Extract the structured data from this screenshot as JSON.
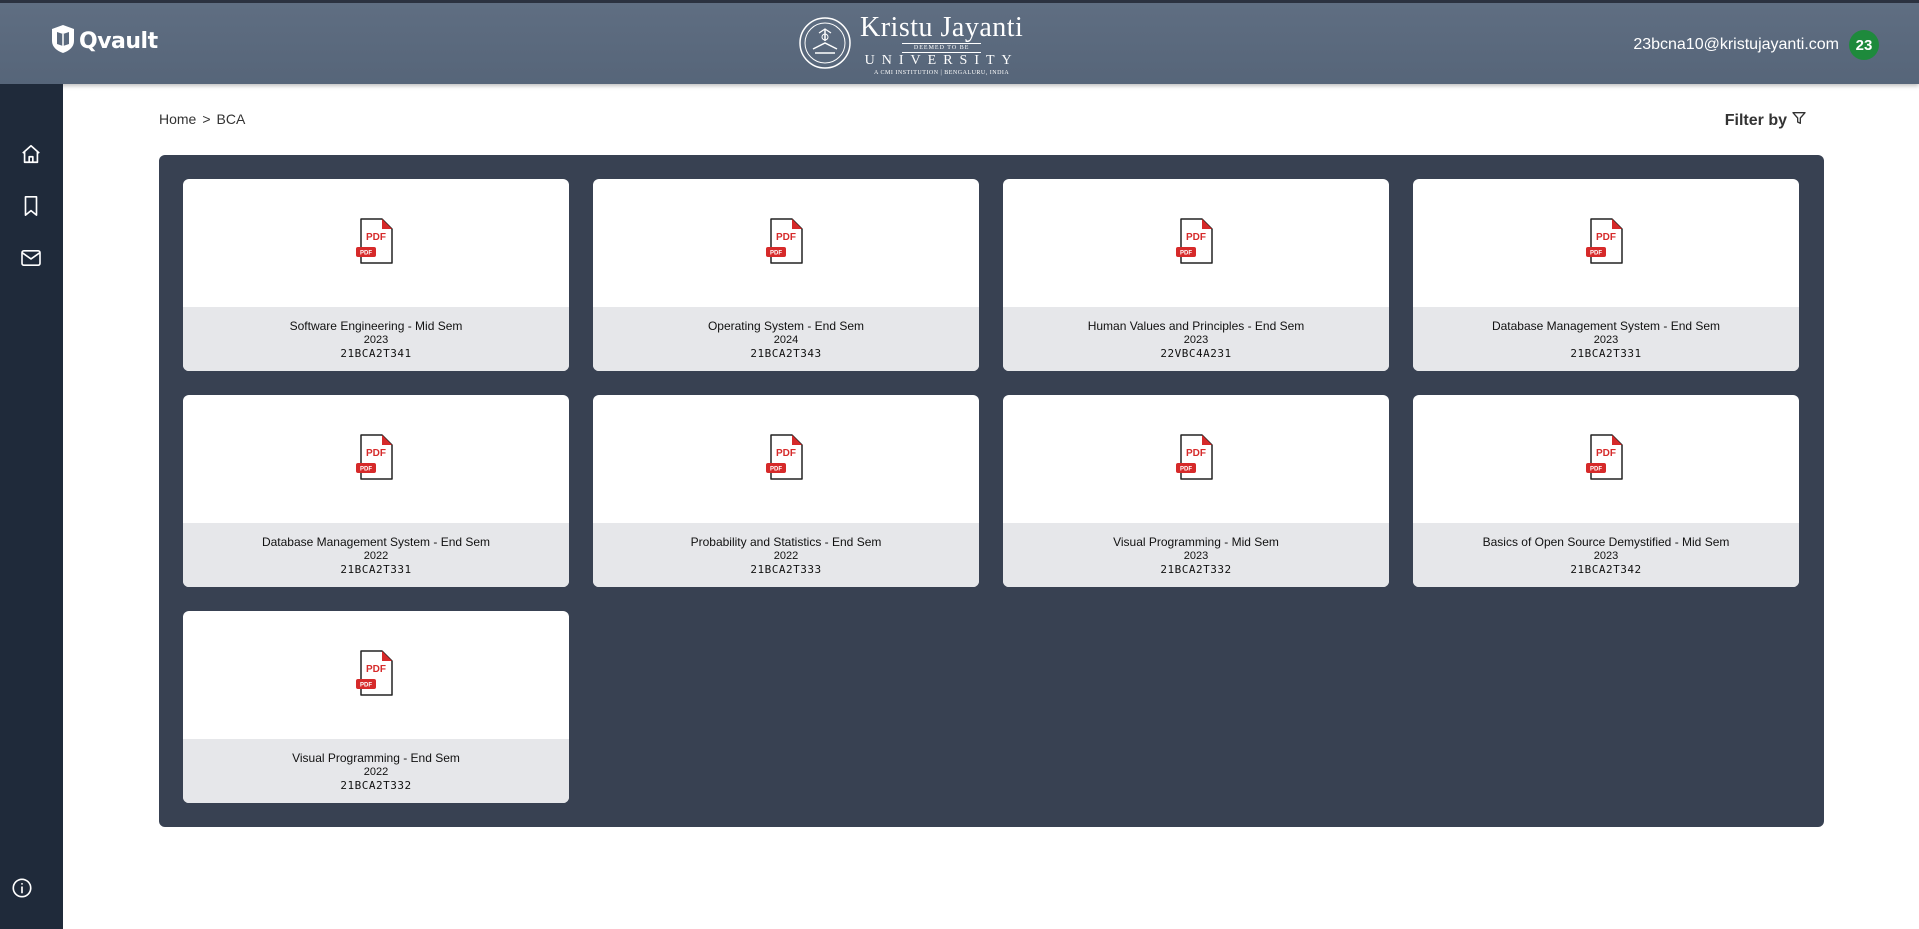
{
  "header": {
    "app_name": "Qvault",
    "university": {
      "name": "Kristu Jayanti",
      "deemed": "DEEMED TO BE",
      "word": "UNIVERSITY",
      "tagline": "A CMI INSTITUTION | BENGALURU, INDIA"
    },
    "user_email": "23bcna10@kristujayanti.com",
    "avatar_text": "23"
  },
  "sidebar": {
    "items": [
      {
        "icon": "home-icon"
      },
      {
        "icon": "bookmark-icon"
      },
      {
        "icon": "mail-icon"
      }
    ],
    "bottom_icon": "info-icon"
  },
  "breadcrumb": {
    "home": "Home",
    "separator": ">",
    "current": "BCA"
  },
  "filter": {
    "label": "Filter by"
  },
  "pdf_badge": "PDF",
  "pdf_small_badge": "PDF",
  "papers": [
    {
      "title": "Software Engineering - Mid Sem",
      "year": "2023",
      "code": "21BCA2T341"
    },
    {
      "title": "Operating System - End Sem",
      "year": "2024",
      "code": "21BCA2T343"
    },
    {
      "title": "Human Values and Principles - End Sem",
      "year": "2023",
      "code": "22VBC4A231"
    },
    {
      "title": "Database Management System - End Sem",
      "year": "2023",
      "code": "21BCA2T331"
    },
    {
      "title": "Database Management System - End Sem",
      "year": "2022",
      "code": "21BCA2T331"
    },
    {
      "title": "Probability and Statistics - End Sem",
      "year": "2022",
      "code": "21BCA2T333"
    },
    {
      "title": "Visual Programming - Mid Sem",
      "year": "2023",
      "code": "21BCA2T332"
    },
    {
      "title": "Basics of Open Source Demystified - Mid Sem",
      "year": "2023",
      "code": "21BCA2T342"
    },
    {
      "title": "Visual Programming - End Sem",
      "year": "2022",
      "code": "21BCA2T332"
    }
  ],
  "colors": {
    "header": "#5b6a7e",
    "sidebar": "#1f2a3a",
    "panel": "#384152",
    "avatar": "#1e8a3c",
    "pdf_red": "#d62a2a"
  }
}
